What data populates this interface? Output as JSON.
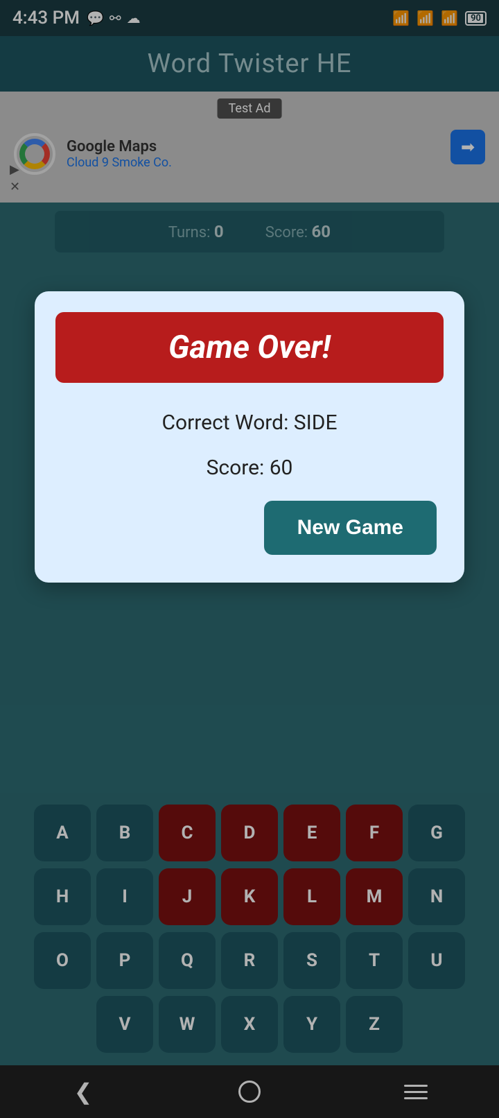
{
  "statusBar": {
    "time": "4:43 PM",
    "battery": "90"
  },
  "header": {
    "title": "Word Twister HE"
  },
  "ad": {
    "label": "Test Ad",
    "company": "Google Maps",
    "subtitle": "Cloud 9 Smoke Co."
  },
  "gameStats": {
    "turns_label": "Turns:",
    "turns_value": "0",
    "score_label": "Score:",
    "score_value": "60"
  },
  "modal": {
    "game_over_text": "Game Over!",
    "correct_word_label": "Correct Word: SIDE",
    "score_label": "Score: 60",
    "new_game_button": "New Game"
  },
  "keyboard": {
    "row1": [
      "A",
      "B",
      "C",
      "D",
      "E",
      "F",
      "G"
    ],
    "row2": [
      "H",
      "I",
      "J",
      "K",
      "L",
      "M",
      "N"
    ],
    "row3": [
      "O",
      "P",
      "Q",
      "R",
      "S",
      "T",
      "U"
    ],
    "row4": [
      "V",
      "W",
      "X",
      "Y",
      "Z"
    ],
    "used_keys": [
      "C",
      "D",
      "E",
      "F",
      "J",
      "K",
      "L",
      "M"
    ]
  }
}
